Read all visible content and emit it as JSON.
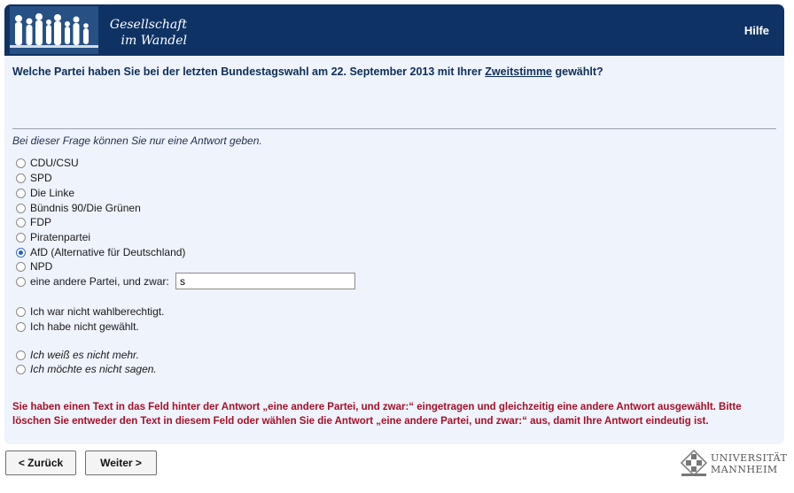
{
  "header": {
    "logo_line1": "Gesellschaft",
    "logo_line2": "im Wandel",
    "help_label": "Hilfe",
    "bg_color": "#0e3264"
  },
  "question": {
    "before": "Welche Partei haben Sie bei der letzten Bundestagswahl am 22. September 2013 mit Ihrer ",
    "link": "Zweitstimme",
    "after": " gewählt?"
  },
  "instruction": "Bei dieser Frage können Sie nur eine Antwort geben.",
  "options": [
    {
      "label": "CDU/CSU",
      "checked": false
    },
    {
      "label": "SPD",
      "checked": false
    },
    {
      "label": "Die Linke",
      "checked": false
    },
    {
      "label": "Bündnis 90/Die Grünen",
      "checked": false
    },
    {
      "label": "FDP",
      "checked": false
    },
    {
      "label": "Piratenpartei",
      "checked": false
    },
    {
      "label": "AfD (Alternative für Deutschland)",
      "checked": true
    },
    {
      "label": "NPD",
      "checked": false
    },
    {
      "label": "eine andere Partei, und zwar:",
      "checked": false,
      "input_value": "s"
    },
    {
      "label": "Ich war nicht wahlberechtigt.",
      "checked": false
    },
    {
      "label": "Ich habe nicht gewählt.",
      "checked": false
    },
    {
      "label": "Ich weiß es nicht mehr.",
      "checked": false
    },
    {
      "label": "Ich möchte es nicht sagen.",
      "checked": false
    }
  ],
  "error_text": "Sie haben einen Text in das Feld hinter der Antwort „eine andere Partei, und zwar:“ eingetragen und gleichzeitig eine andere Antwort ausgewählt. Bitte löschen Sie entweder den Text in diesem Feld oder wählen Sie die Antwort „eine andere Partei, und zwar:“ aus, damit Ihre Antwort eindeutig ist.",
  "nav": {
    "back_label": "< Zurück",
    "next_label": "Weiter >"
  },
  "university": {
    "line1": "UNIVERSITÄT",
    "line2": "MANNHEIM"
  },
  "colors": {
    "panel_bg": "#eef3fc",
    "question_text": "#0e2e58",
    "error_text": "#a5102a"
  }
}
